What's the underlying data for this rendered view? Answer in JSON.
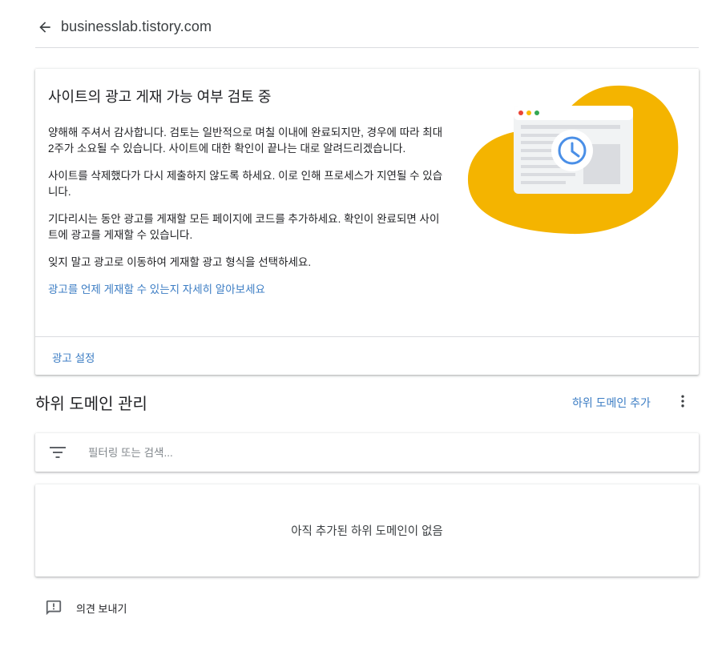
{
  "header": {
    "back_icon": "arrow-back-icon",
    "site": "businesslab.tistory.com"
  },
  "review_card": {
    "title": "사이트의 광고 게재 가능 여부 검토 중",
    "paragraphs": [
      "양해해 주셔서 감사합니다. 검토는 일반적으로 며칠 이내에 완료되지만, 경우에 따라 최대 2주가 소요될 수 있습니다. 사이트에 대한 확인이 끝나는 대로 알려드리겠습니다.",
      "사이트를 삭제했다가 다시 제출하지 않도록 하세요. 이로 인해 프로세스가 지연될 수 있습니다.",
      "기다리시는 동안 광고를 게재할 모든 페이지에 코드를 추가하세요. 확인이 완료되면 사이트에 광고를 게재할 수 있습니다.",
      "잊지 말고 광고로 이동하여 게재할 광고 형식을 선택하세요."
    ],
    "learn_more_link": "광고를 언제 게재할 수 있는지 자세히 알아보세요",
    "footer_link": "광고 설정",
    "illustration": "browser-clock-illustration",
    "colors": {
      "blob": "#f4b400",
      "clock": "#4a8fe7",
      "dot_red": "#ea4335",
      "dot_yellow": "#fbbc04",
      "dot_green": "#34a853"
    }
  },
  "subdomain": {
    "title": "하위 도메인 관리",
    "add_label": "하위 도메인 추가",
    "more_icon": "more-vert-icon",
    "filter_icon": "filter-list-icon",
    "filter_placeholder": "필터링 또는 검색...",
    "empty_message": "아직 추가된 하위 도메인이 없음"
  },
  "feedback": {
    "icon": "feedback-icon",
    "label": "의견 보내기"
  },
  "colors": {
    "link": "#3c7dc4",
    "divider": "#dadce0",
    "text": "#202124"
  }
}
